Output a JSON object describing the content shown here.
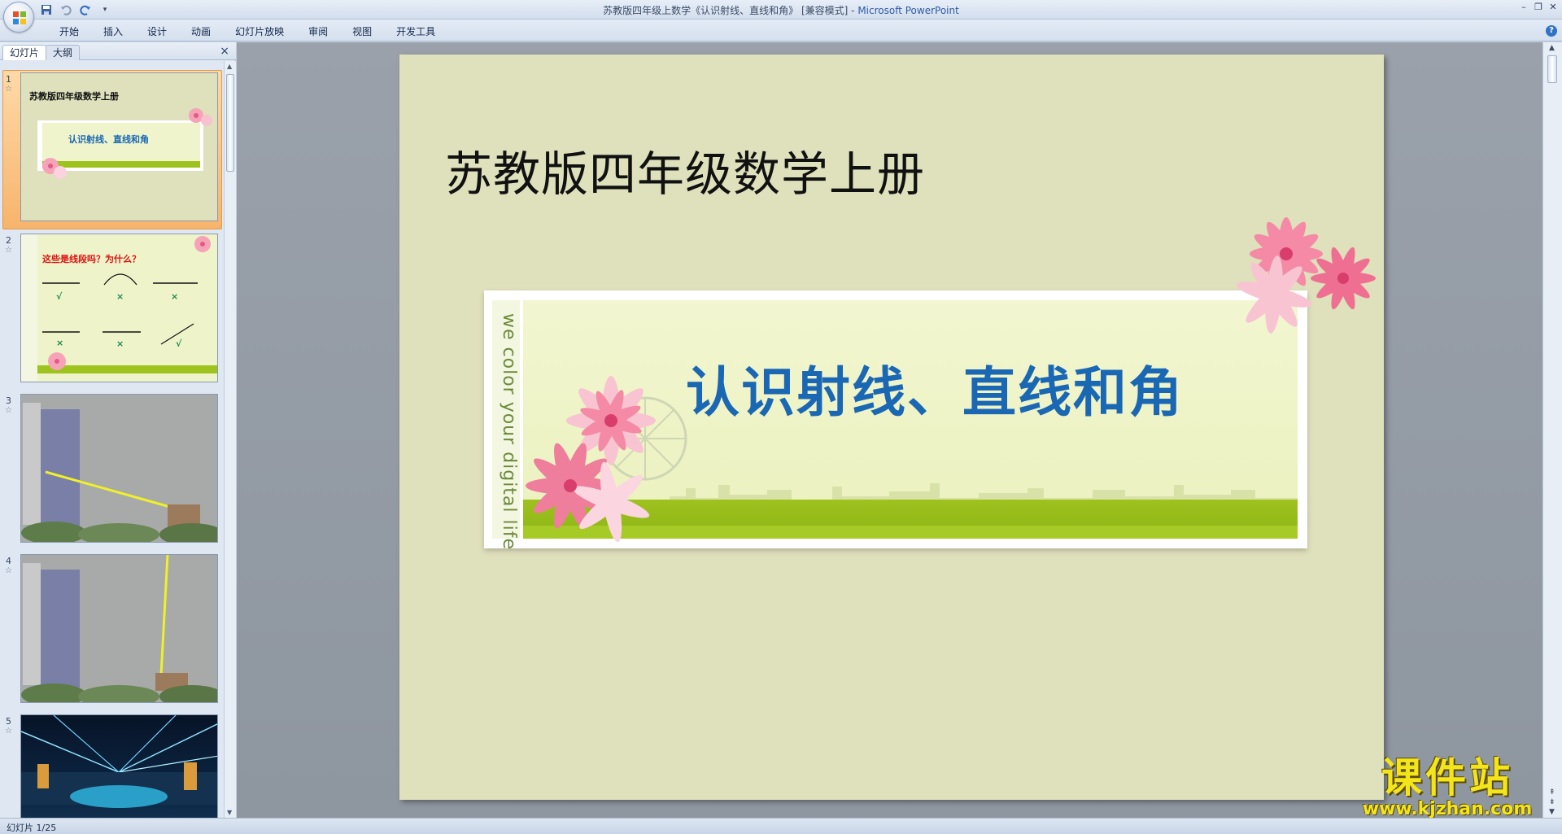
{
  "window": {
    "title_doc": "苏教版四年级上数学《认识射线、直线和角》 [兼容模式] - ",
    "title_app": "Microsoft PowerPoint"
  },
  "ribbon": {
    "tabs": [
      "开始",
      "插入",
      "设计",
      "动画",
      "幻灯片放映",
      "审阅",
      "视图",
      "开发工具"
    ]
  },
  "left_pane": {
    "tab_slides": "幻灯片",
    "tab_outline": "大纲",
    "close": "×",
    "thumbnails": [
      {
        "num": "1",
        "star": "☆",
        "title": "苏教版四年级数学上册",
        "banner": "认识射线、直线和角"
      },
      {
        "num": "2",
        "star": "☆",
        "title": "这些是线段吗？为什么？",
        "marks": [
          "√",
          "×",
          "×",
          "×",
          "×",
          "√"
        ]
      },
      {
        "num": "3",
        "star": "☆"
      },
      {
        "num": "4",
        "star": "☆"
      },
      {
        "num": "5",
        "star": "☆"
      }
    ]
  },
  "slide": {
    "title": "苏教版四年级数学上册",
    "banner_title": "认识射线、直线和角",
    "vertical_text": "we color your digital life"
  },
  "status": {
    "text": "幻灯片 1/25"
  },
  "watermark": {
    "title": "课件站",
    "url": "www.kjzhan.com"
  },
  "colors": {
    "slide_bg": "#dfe0bc",
    "banner_title": "#1a67b4",
    "banner_green": "#9ec21e",
    "selected_thumb": "#f7b46c",
    "watermark": "#f3e51c"
  }
}
